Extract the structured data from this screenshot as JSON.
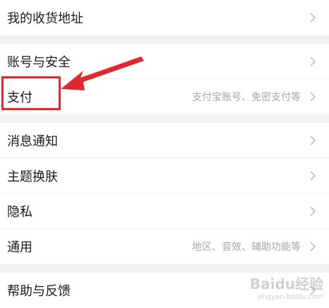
{
  "groups": [
    {
      "items": [
        {
          "label": "我的收货地址",
          "sub": ""
        }
      ]
    },
    {
      "items": [
        {
          "label": "账号与安全",
          "sub": ""
        },
        {
          "label": "支付",
          "sub": "支付宝账号、免密支付等"
        }
      ]
    },
    {
      "items": [
        {
          "label": "消息通知",
          "sub": ""
        },
        {
          "label": "主题换肤",
          "sub": ""
        },
        {
          "label": "隐私",
          "sub": ""
        },
        {
          "label": "通用",
          "sub": "地区、音效、辅助功能等"
        }
      ]
    },
    {
      "items": [
        {
          "label": "帮助与反馈",
          "sub": ""
        }
      ]
    }
  ],
  "icons": {
    "chevron": "chevron-right-icon",
    "annotation_arrow": "red-arrow-icon"
  },
  "colors": {
    "annotation": "#e0282e",
    "text": "#1b1b1b",
    "subtext": "#a6a6a6",
    "background": "#f2f2f2"
  },
  "watermark": {
    "brand": "Baidu经验",
    "url": "jingyan.baidu.com"
  }
}
